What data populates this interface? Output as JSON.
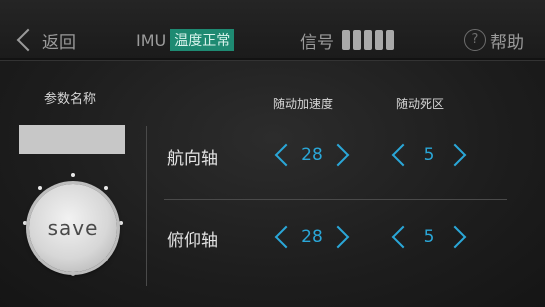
{
  "topbar": {
    "back_label": "返回",
    "imu_label": "IMU",
    "imu_status": "温度正常",
    "signal_label": "信号",
    "signal_bars": 5,
    "help_symbol": "?",
    "help_label": "帮助"
  },
  "left_panel": {
    "param_title": "参数名称",
    "save_label": "save"
  },
  "columns": {
    "accel_header": "随动加速度",
    "deadzone_header": "随动死区"
  },
  "rows": [
    {
      "axis": "航向轴",
      "accel": "28",
      "deadzone": "5"
    },
    {
      "axis": "俯仰轴",
      "accel": "28",
      "deadzone": "5"
    }
  ],
  "colors": {
    "accent": "#2aa7d8",
    "status_badge": "#1e8a72"
  }
}
